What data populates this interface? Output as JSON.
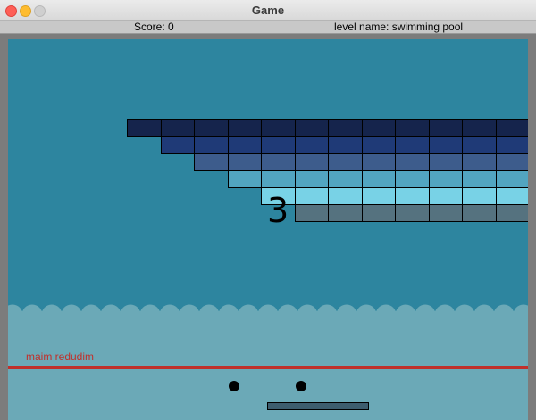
{
  "window": {
    "title": "Game"
  },
  "status": {
    "score": "Score: 0",
    "level": "level name: swimming pool"
  },
  "game": {
    "countdown": "3",
    "deathzone_label": "maim redudim",
    "colors": {
      "row1": "#15244c",
      "row2": "#1f3a77",
      "row3": "#3d5c8c",
      "row4": "#52a5c0",
      "row5": "#78d2e6",
      "row6": "#55727f",
      "background": "#2d859f",
      "water": "#6ba9b7",
      "deathline": "#c0302b",
      "paddle": "#3d5d6e"
    },
    "block_rows": [
      {
        "color_key": "row1",
        "count": 12
      },
      {
        "color_key": "row2",
        "count": 11
      },
      {
        "color_key": "row3",
        "count": 10
      },
      {
        "color_key": "row4",
        "count": 9
      },
      {
        "color_key": "row5",
        "count": 8
      },
      {
        "color_key": "row6",
        "count": 7
      }
    ],
    "balls": 2
  }
}
